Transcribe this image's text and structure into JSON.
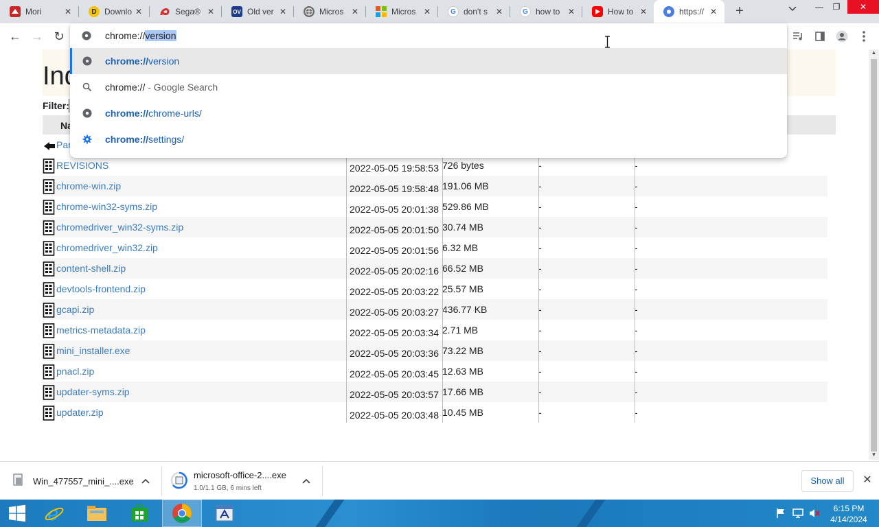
{
  "tabs": [
    {
      "title": "Mori",
      "close": "✕",
      "favicon": "tab-favicon-bird",
      "color": "#c62828"
    },
    {
      "title": "Downlo",
      "close": "✕",
      "favicon": "tab-favicon-download",
      "color": "#f4c20d"
    },
    {
      "title": "Sega®",
      "close": "✕",
      "favicon": "tab-favicon-sega",
      "color": "#d32f2f"
    },
    {
      "title": "Old ver",
      "close": "✕",
      "favicon": "tab-favicon-ov",
      "color": "#1f3c88"
    },
    {
      "title": "Micros",
      "close": "✕",
      "favicon": "tab-favicon-globe",
      "color": "#6e6e6e"
    },
    {
      "title": "Micros",
      "close": "✕",
      "favicon": "tab-favicon-microsoft",
      "color": "#f35325"
    },
    {
      "title": "don't s",
      "close": "✕",
      "favicon": "tab-favicon-google",
      "color": "#4285f4"
    },
    {
      "title": "how to",
      "close": "✕",
      "favicon": "tab-favicon-google",
      "color": "#4285f4"
    },
    {
      "title": "How to",
      "close": "✕",
      "favicon": "tab-favicon-youtube",
      "color": "#ff0000"
    },
    {
      "title": "https://",
      "close": "✕",
      "favicon": "tab-favicon-chromium",
      "color": "#4a7fe0"
    }
  ],
  "tabstrip": {
    "new_tab": "+",
    "tab_search": "⌄"
  },
  "window": {
    "minimize": "—",
    "maximize": "❐",
    "close": "✕"
  },
  "toolbar": {
    "back": "←",
    "forward": "→",
    "reload": "↻"
  },
  "omnibox": {
    "typed": "chrome://",
    "selected_completion": "version",
    "suggestions": [
      {
        "bold": "chrome://",
        "rest": "version",
        "icon": "globe-icon",
        "selected": true
      },
      {
        "bold": "",
        "rest": "chrome://",
        "suffix": " - Google Search",
        "icon": "search-icon",
        "selected": false
      },
      {
        "bold": "chrome://",
        "rest": "chrome-urls/",
        "icon": "globe-icon",
        "selected": false
      },
      {
        "bold": "chrome://",
        "rest": "settings/",
        "icon": "settings-gear-icon",
        "selected": false
      }
    ]
  },
  "page": {
    "heading": "Ind",
    "filter_label": "Filter:",
    "name_header": "Na",
    "parent_link": "Par",
    "files": [
      {
        "name": "REVISIONS",
        "date": "2022-05-05 19:58:53",
        "size": "726 bytes",
        "c1": "-",
        "c2": "-"
      },
      {
        "name": "chrome-win.zip",
        "date": "2022-05-05 19:58:48",
        "size": "191.06 MB",
        "c1": "-",
        "c2": "-"
      },
      {
        "name": "chrome-win32-syms.zip",
        "date": "2022-05-05 20:01:38",
        "size": "529.86 MB",
        "c1": "-",
        "c2": "-"
      },
      {
        "name": "chromedriver_win32-syms.zip",
        "date": "2022-05-05 20:01:50",
        "size": "30.74 MB",
        "c1": "-",
        "c2": "-"
      },
      {
        "name": "chromedriver_win32.zip",
        "date": "2022-05-05 20:01:56",
        "size": "6.32 MB",
        "c1": "-",
        "c2": "-"
      },
      {
        "name": "content-shell.zip",
        "date": "2022-05-05 20:02:16",
        "size": "66.52 MB",
        "c1": "-",
        "c2": "-"
      },
      {
        "name": "devtools-frontend.zip",
        "date": "2022-05-05 20:03:22",
        "size": "25.57 MB",
        "c1": "-",
        "c2": "-"
      },
      {
        "name": "gcapi.zip",
        "date": "2022-05-05 20:03:27",
        "size": "436.77 KB",
        "c1": "-",
        "c2": "-"
      },
      {
        "name": "metrics-metadata.zip",
        "date": "2022-05-05 20:03:34",
        "size": "2.71 MB",
        "c1": "-",
        "c2": "-"
      },
      {
        "name": "mini_installer.exe",
        "date": "2022-05-05 20:03:36",
        "size": "73.22 MB",
        "c1": "-",
        "c2": "-"
      },
      {
        "name": "pnacl.zip",
        "date": "2022-05-05 20:03:45",
        "size": "12.63 MB",
        "c1": "-",
        "c2": "-"
      },
      {
        "name": "updater-syms.zip",
        "date": "2022-05-05 20:03:57",
        "size": "17.66 MB",
        "c1": "-",
        "c2": "-"
      },
      {
        "name": "updater.zip",
        "date": "2022-05-05 20:03:48",
        "size": "10.45 MB",
        "c1": "-",
        "c2": "-"
      }
    ]
  },
  "downloads": {
    "items": [
      {
        "name": "Win_477557_mini_....exe",
        "status": "",
        "chevron": "^"
      },
      {
        "name": "microsoft-office-2....exe",
        "status": "1.0/1.1 GB, 6 mins left",
        "chevron": "^"
      }
    ],
    "show_all": "Show all",
    "close": "✕"
  },
  "taskbar": {
    "time": "6:15 PM",
    "date": "4/14/2024",
    "apps": [
      "start-button",
      "internet-explorer",
      "file-explorer",
      "store",
      "chrome",
      "wordpad"
    ]
  },
  "colors": {
    "accent": "#1a73e8",
    "link": "#3b7bbf",
    "taskbar": "#1d7bbd"
  }
}
